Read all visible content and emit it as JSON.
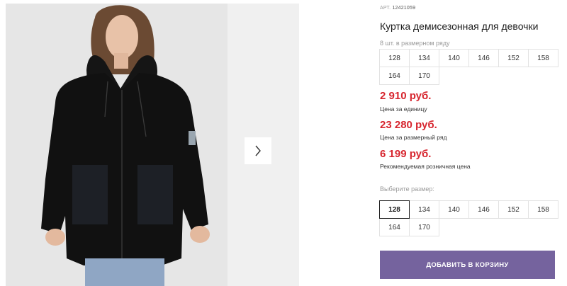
{
  "product": {
    "article_label": "АРТ.",
    "article_value": "12421059",
    "title": "Куртка демисезонная для девочки",
    "pack_count_label": "8 шт. в размерном ряду"
  },
  "size_row": [
    "128",
    "134",
    "140",
    "146",
    "152",
    "158",
    "164",
    "170"
  ],
  "prices": [
    {
      "value": "2 910 руб.",
      "note": "Цена за единицу"
    },
    {
      "value": "23 280 руб.",
      "note": "Цена за размерный ряд"
    },
    {
      "value": "6 199 руб.",
      "note": "Рекомендуемая розничная цена"
    }
  ],
  "size_select": {
    "label": "Выберите размер:",
    "selected": "128",
    "options": [
      "128",
      "134",
      "140",
      "146",
      "152",
      "158",
      "164",
      "170"
    ]
  },
  "cart_button_label": "ДОБАВИТЬ В КОРЗИНУ",
  "colors": {
    "price": "#d7262f",
    "cart_button": "#75639e",
    "gallery_bg": "#e6e6e6",
    "jacket": "#111111"
  },
  "icons": {
    "next": "chevron-right-icon"
  }
}
